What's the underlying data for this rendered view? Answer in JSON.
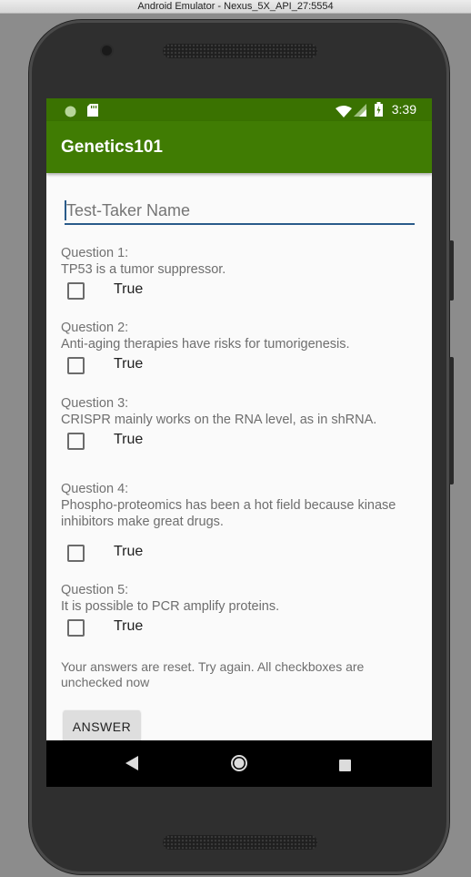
{
  "window": {
    "title": "Android Emulator - Nexus_5X_API_27:5554"
  },
  "statusbar": {
    "time": "3:39"
  },
  "app": {
    "title": "Genetics101"
  },
  "name_field": {
    "placeholder": "Test-Taker Name",
    "value": ""
  },
  "questions": [
    {
      "label": "Question 1:",
      "text": "TP53 is a tumor suppressor.",
      "option": "True",
      "checked": false
    },
    {
      "label": "Question 2:",
      "text": "Anti-aging therapies have risks for tumorigenesis.",
      "option": "True",
      "checked": false
    },
    {
      "label": "Question 3:",
      "text": "CRISPR mainly works on the RNA level, as in shRNA.",
      "option": "True",
      "checked": false
    },
    {
      "label": "Question 4:",
      "text": "Phospho-proteomics has been a hot field because kinase inhibitors make great drugs.",
      "option": "True",
      "checked": false
    },
    {
      "label": "Question 5:",
      "text": "It is possible to PCR amplify proteins.",
      "option": "True",
      "checked": false
    }
  ],
  "result_text": "Your answers are reset. Try again. All checkboxes are unchecked now",
  "answer_button": {
    "label": "ANSWER"
  },
  "colors": {
    "statusbar": "#3a7201",
    "appbar": "#407c03",
    "accent": "#2a5b8a"
  },
  "icons": {
    "status": [
      "notification-dot-icon",
      "sd-card-icon",
      "wifi-icon",
      "signal-icon",
      "battery-icon"
    ],
    "nav": [
      "back-icon",
      "home-icon",
      "recents-icon"
    ]
  }
}
